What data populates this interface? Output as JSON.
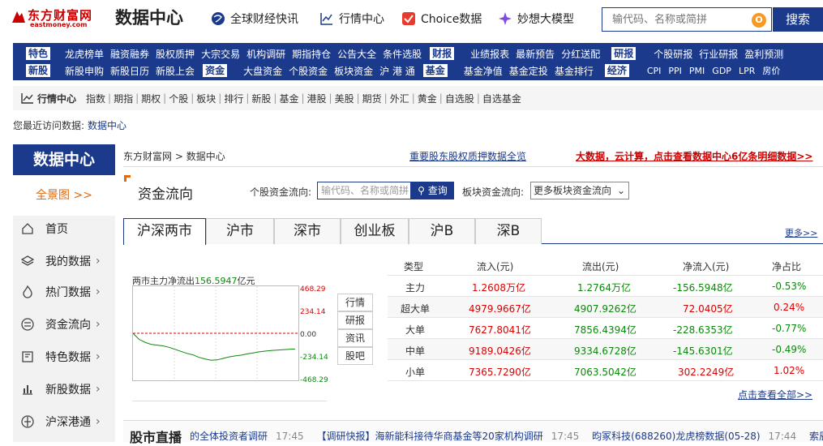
{
  "logo": {
    "cn": "东方财富网",
    "en": "eastmoney.com"
  },
  "site_title": "数据中心",
  "header_nav": [
    "全球财经快讯",
    "行情中心",
    "Choice数据",
    "妙想大模型"
  ],
  "search": {
    "placeholder": "输代码、名称或简拼",
    "button": "搜索"
  },
  "bluebar": {
    "row1": {
      "tag1": "特色",
      "g1": [
        "龙虎榜单",
        "融资融券",
        "股权质押",
        "大宗交易",
        "机构调研",
        "期指持仓",
        "公告大全",
        "条件选股"
      ],
      "tag2": "财报",
      "g2": [
        "业绩报表",
        "最新预告",
        "分红送配"
      ],
      "tag3": "研报",
      "g3": [
        "个股研报",
        "行业研报",
        "盈利预测"
      ]
    },
    "row2": {
      "tag1": "新股",
      "g1": [
        "新股申购",
        "新股日历",
        "新股上会"
      ],
      "tag2": "资金",
      "g2": [
        "大盘资金",
        "个股资金",
        "板块资金",
        "沪 港 通"
      ],
      "tag3": "基金",
      "g3": [
        "基金净值",
        "基金定投",
        "基金排行"
      ],
      "tag4": "经济",
      "g4": [
        "CPI",
        "PPI",
        "PMI",
        "GDP",
        "LPR",
        "房价"
      ]
    }
  },
  "subnav": {
    "title": "行情中心",
    "items": [
      "指数",
      "期指",
      "期权",
      "个股",
      "板块",
      "排行",
      "新股",
      "基金",
      "港股",
      "美股",
      "期货",
      "外汇",
      "黄金",
      "自选股",
      "自选基金"
    ]
  },
  "recent": {
    "label": "您最近访问数据:",
    "link": "数据中心"
  },
  "sidebar": {
    "title": "数据中心",
    "all": "全景图 >>",
    "items": [
      "首页",
      "我的数据",
      "热门数据",
      "资金流向",
      "特色数据",
      "新股数据",
      "沪深港通"
    ]
  },
  "breadcrumb": {
    "home": "东方财富网",
    "sep": ">",
    "current": "数据中心"
  },
  "promo_mid": "重要股东股权质押数据全览",
  "promo_right": "大数据，云计算，点击查看数据中心6亿条明细数据>>",
  "section": {
    "title": "资金流向",
    "stock_label": "个股资金流向:",
    "stock_placeholder": "输代码、名称或简拼",
    "query_button": "查询",
    "block_label": "板块资金流向:",
    "block_select": "更多板块资金流向"
  },
  "tabs": [
    "沪深两市",
    "沪市",
    "深市",
    "创业板",
    "沪B",
    "深B"
  ],
  "more_link": "更多>>",
  "chart": {
    "label_prefix": "两市主力净流出",
    "label_value": "156.5947",
    "label_unit": "亿元",
    "y_labels": [
      "468.29",
      "234.14",
      "0.00",
      "-234.14",
      "-468.29"
    ],
    "buttons": [
      "行情",
      "研报",
      "资讯",
      "股吧"
    ]
  },
  "chart_data": {
    "type": "line",
    "title": "两市主力净流出156.5947亿元",
    "ylim": [
      -468.29,
      468.29
    ],
    "y_ticks": [
      468.29,
      234.14,
      0.0,
      -234.14,
      -468.29
    ],
    "series": [
      {
        "values": [
          0,
          -60,
          -90,
          -110,
          -118,
          -125,
          -140,
          -160,
          -180,
          -200,
          -215,
          -240,
          -255,
          -268,
          -265,
          -250,
          -235,
          -225,
          -218,
          -205,
          -195,
          -185,
          -178,
          -172,
          -168,
          -164,
          -160,
          -157
        ]
      }
    ]
  },
  "flow_table": {
    "headers": [
      "类型",
      "流入(元)",
      "流出(元)",
      "净流入(元)",
      "净占比"
    ],
    "rows": [
      [
        "主力",
        "1.2608万亿",
        "1.2764万亿",
        "-156.5948亿",
        "-0.53%"
      ],
      [
        "超大单",
        "4979.9667亿",
        "4907.9262亿",
        "72.0405亿",
        "0.24%"
      ],
      [
        "大单",
        "7627.8041亿",
        "7856.4394亿",
        "-228.6353亿",
        "-0.77%"
      ],
      [
        "中单",
        "9189.0426亿",
        "9334.6728亿",
        "-145.6301亿",
        "-0.49%"
      ],
      [
        "小单",
        "7365.7290亿",
        "7063.5042亿",
        "302.2249亿",
        "1.02%"
      ]
    ],
    "see_all": "点击查看全部>>"
  },
  "live": {
    "title": "股市直播",
    "news": [
      {
        "text": "的全体投资者调研",
        "time": "17:45"
      },
      {
        "text": "【调研快报】海新能科接待华商基金等20家机构调研",
        "time": "17:45"
      },
      {
        "text": "昀冢科技(688260)龙虎榜数据(05-28)",
        "time": "17:44"
      },
      {
        "text": "索辰科技(",
        "time": ""
      }
    ]
  },
  "colors": {
    "brand_blue": "#1b3a8c",
    "accent_red": "#cc0000",
    "accent_orange": "#e06a10",
    "down_green": "#0a8a0a"
  }
}
